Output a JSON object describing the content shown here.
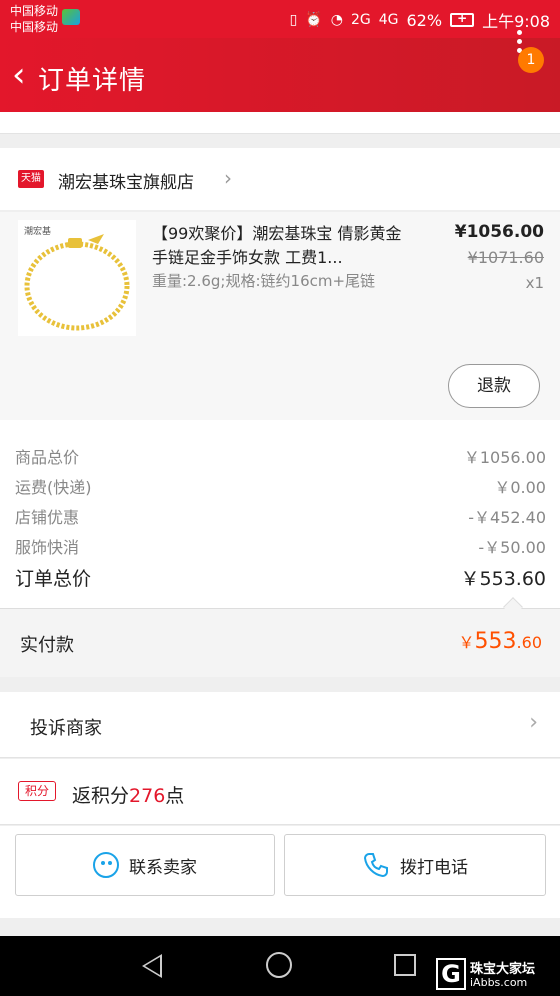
{
  "status_bar": {
    "carrier_1": "中国移动",
    "carrier_2": "中国移动",
    "signal_2g": "2G",
    "signal_4g": "4G",
    "battery": "62%",
    "time": "上午9:08"
  },
  "header": {
    "title": "订单详情",
    "badge": "1"
  },
  "shop": {
    "tag": "天猫",
    "name": "潮宏基珠宝旗舰店"
  },
  "product": {
    "thumb_brand": "潮宏基",
    "title": "【99欢聚价】潮宏基珠宝 倩影黄金手链足金手饰女款 工费1...",
    "spec": "重量:2.6g;规格:链约16cm+尾链",
    "price_now": "¥1056.00",
    "price_old": "¥1071.60",
    "qty": "x1",
    "refund_label": "退款"
  },
  "costs": [
    {
      "label": "商品总价",
      "value": "￥1056.00"
    },
    {
      "label": "运费(快递)",
      "value": "￥0.00"
    },
    {
      "label": "店铺优惠",
      "value": "-￥452.40"
    },
    {
      "label": "服饰快消",
      "value": "-￥50.00"
    }
  ],
  "order_total": {
    "label": "订单总价",
    "value": "￥553.60"
  },
  "paid": {
    "label": "实付款",
    "currency": "￥",
    "amount_int": "553",
    "amount_dec": ".60"
  },
  "complaint": {
    "label": "投诉商家"
  },
  "points": {
    "tag": "积分",
    "prefix": "返积分",
    "amount": "276",
    "suffix": "点"
  },
  "actions": {
    "contact_label": "联系卖家",
    "call_label": "拨打电话"
  },
  "watermark": {
    "line1": "珠宝大家坛",
    "line2": "iAbbs.com"
  },
  "colors": {
    "brand_red": "#e3172b",
    "price_orange": "#ff5000",
    "icon_blue": "#1aa3e8"
  }
}
